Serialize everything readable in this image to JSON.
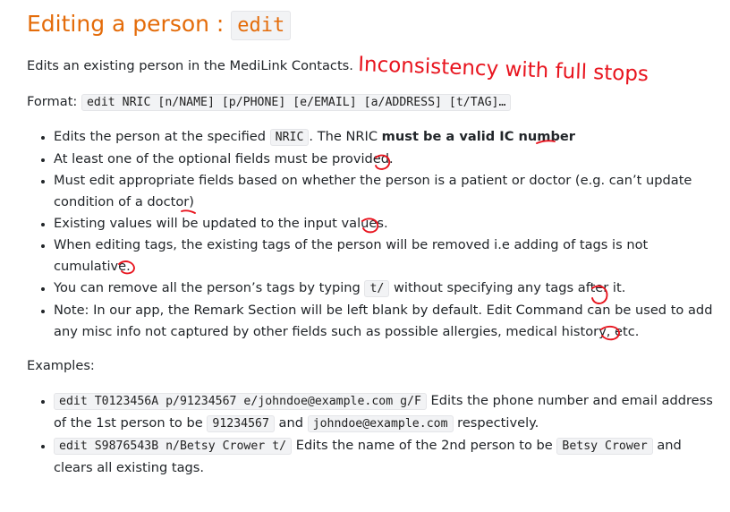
{
  "heading": {
    "prefix": "Editing a person : ",
    "command": "edit"
  },
  "description": "Edits an existing person in the MediLink Contacts.",
  "format": {
    "label": "Format: ",
    "syntax": "edit NRIC [n/NAME] [p/PHONE] [e/EMAIL] [a/ADDRESS] [t/TAG]…"
  },
  "bullets": {
    "b1": {
      "pre": "Edits the person at the specified ",
      "code": "NRIC",
      "mid": ". The NRIC ",
      "bold": "must be a valid IC number"
    },
    "b2": "At least one of the optional fields must be provided.",
    "b3": "Must edit appropriate fields based on whether the person is a patient or doctor (e.g. can’t update condition of a doctor)",
    "b4": "Existing values will be updated to the input values.",
    "b5": "When editing tags, the existing tags of the person will be removed i.e adding of tags is not cumulative.",
    "b6": {
      "pre": "You can remove all the person’s tags by typing ",
      "code": "t/",
      "post": " without specifying any tags after it."
    },
    "b7": "Note: In our app, the Remark Section will be left blank by default. Edit Command can be used to add any misc info not captured by other fields such as possible allergies, medical history, etc."
  },
  "examples": {
    "label": "Examples:",
    "e1": {
      "code": "edit T0123456A p/91234567 e/johndoe@example.com g/F",
      "t1": " Edits the phone number and email address of the 1st person to be ",
      "c2": "91234567",
      "t2": " and ",
      "c3": "johndoe@example.com",
      "t3": " respectively."
    },
    "e2": {
      "code": "edit S9876543B n/Betsy Crower t/",
      "t1": " Edits the name of the 2nd person to be ",
      "c2": "Betsy Crower",
      "t2": " and clears all existing tags."
    }
  },
  "annotation": {
    "text": "Inconsistency with full stops",
    "color": "#e8141e"
  }
}
